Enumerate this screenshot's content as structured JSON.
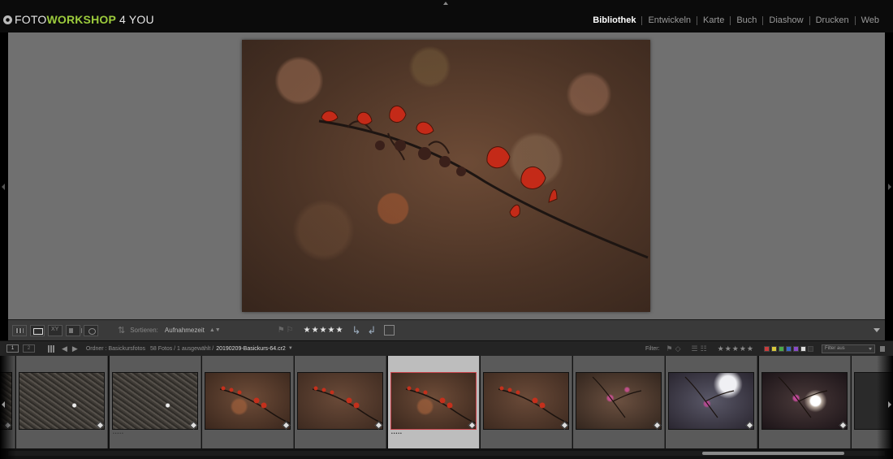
{
  "brand": {
    "part1": "FOTO",
    "part2": "WORKSHOP",
    "part3": "4 YOU"
  },
  "modules": [
    "Bibliothek",
    "Entwickeln",
    "Karte",
    "Buch",
    "Diashow",
    "Drucken",
    "Web"
  ],
  "active_module": "Bibliothek",
  "toolbar": {
    "sort_label": "Sortieren:",
    "sort_value": "Aufnahmezeit",
    "rating": "★★★★★",
    "icons": [
      "grid-view-icon",
      "loupe-view-icon",
      "compare-view-icon",
      "survey-view-icon",
      "people-view-icon",
      "sort-direction-icon",
      "flag-icon",
      "rotate-left-icon",
      "rotate-right-icon",
      "crop-icon",
      "toolbar-menu-icon"
    ]
  },
  "filmstrip_header": {
    "screen1": "1",
    "screen2": "2",
    "folder": "Ordner : Basickursfotos",
    "count": "58 Fotos / 1 ausgewählt /",
    "filename": "20190209-Basickurs-64.cr2",
    "filter_label": "Filter:",
    "filter_stars": "★★★★★",
    "filter_preset": "Filter aus",
    "color_labels": [
      "#c83c3c",
      "#d8c83a",
      "#4aa84a",
      "#3a66c8",
      "#8a4ac8",
      "#dddddd",
      "#333333"
    ]
  },
  "filmstrip": {
    "thumbnails": [
      {
        "kind": "ground",
        "stars": ""
      },
      {
        "kind": "ground",
        "stars": ""
      },
      {
        "kind": "ground",
        "stars": "•••••"
      },
      {
        "kind": "branch",
        "stars": ""
      },
      {
        "kind": "branch2",
        "stars": ""
      },
      {
        "kind": "branch",
        "stars": "•••••"
      },
      {
        "kind": "branch2",
        "stars": ""
      },
      {
        "kind": "blossom",
        "stars": ""
      },
      {
        "kind": "blossom-bright",
        "stars": ""
      },
      {
        "kind": "blossom-sun",
        "stars": ""
      },
      {
        "kind": "dark",
        "stars": ""
      }
    ],
    "selected_index": 5
  }
}
